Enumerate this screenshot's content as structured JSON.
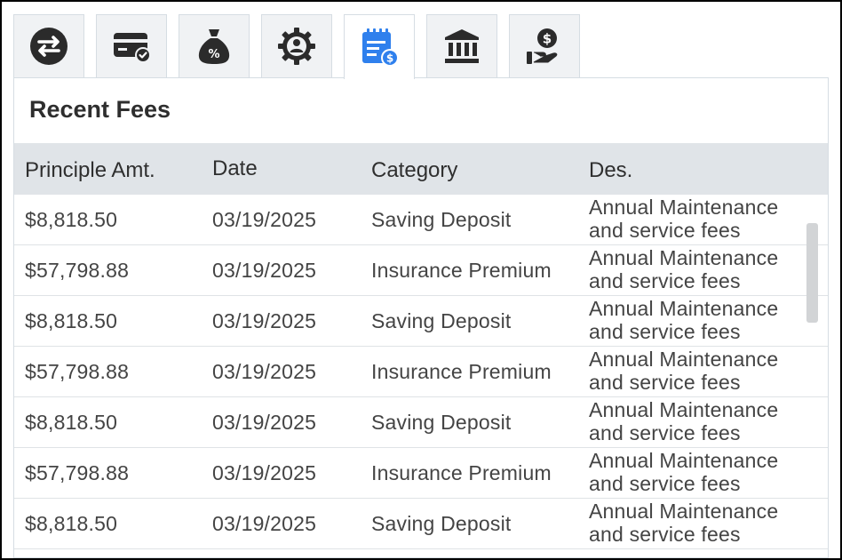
{
  "tabs": [
    {
      "id": "transfer",
      "icon": "transfer-arrows-icon",
      "active": false
    },
    {
      "id": "card",
      "icon": "card-check-icon",
      "active": false
    },
    {
      "id": "interest",
      "icon": "money-bag-percent-icon",
      "active": false
    },
    {
      "id": "settings",
      "icon": "gear-user-icon",
      "active": false
    },
    {
      "id": "fees",
      "icon": "receipt-dollar-icon",
      "active": true
    },
    {
      "id": "bank",
      "icon": "bank-building-icon",
      "active": false
    },
    {
      "id": "loan",
      "icon": "hand-dollar-icon",
      "active": false
    }
  ],
  "colors": {
    "icon_dark": "#2b2b2b",
    "icon_active": "#2f80ed",
    "header_bg": "#e0e4e8"
  },
  "panel": {
    "title": "Recent Fees"
  },
  "table": {
    "columns": {
      "principle": "Principle Amt.",
      "date": "Date",
      "category": "Category",
      "des": "Des."
    },
    "rows": [
      {
        "amount": "$8,818.50",
        "date": "03/19/2025",
        "category": "Saving Deposit",
        "des": "Annual Maintenance and service fees"
      },
      {
        "amount": "$57,798.88",
        "date": "03/19/2025",
        "category": "Insurance Premium",
        "des": "Annual Maintenance and service fees"
      },
      {
        "amount": "$8,818.50",
        "date": "03/19/2025",
        "category": "Saving Deposit",
        "des": "Annual Maintenance and service fees"
      },
      {
        "amount": "$57,798.88",
        "date": "03/19/2025",
        "category": "Insurance Premium",
        "des": "Annual Maintenance and service fees"
      },
      {
        "amount": "$8,818.50",
        "date": "03/19/2025",
        "category": "Saving Deposit",
        "des": "Annual Maintenance and service fees"
      },
      {
        "amount": "$57,798.88",
        "date": "03/19/2025",
        "category": "Insurance Premium",
        "des": "Annual Maintenance and service fees"
      },
      {
        "amount": "$8,818.50",
        "date": "03/19/2025",
        "category": "Saving Deposit",
        "des": "Annual Maintenance and service fees"
      }
    ]
  }
}
